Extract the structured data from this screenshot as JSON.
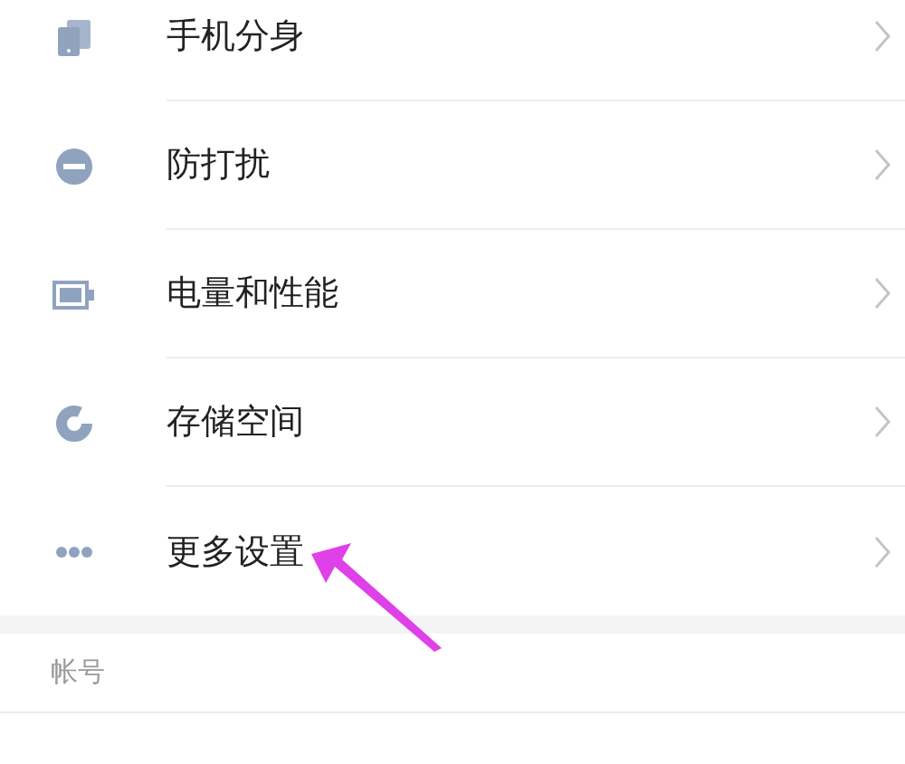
{
  "items": [
    {
      "kind": "clone",
      "label": "手机分身"
    },
    {
      "kind": "dnd",
      "label": "防打扰"
    },
    {
      "kind": "battery",
      "label": "电量和性能"
    },
    {
      "kind": "storage",
      "label": "存储空间"
    },
    {
      "kind": "more",
      "label": "更多设置"
    }
  ],
  "section": {
    "title": "帐号"
  }
}
